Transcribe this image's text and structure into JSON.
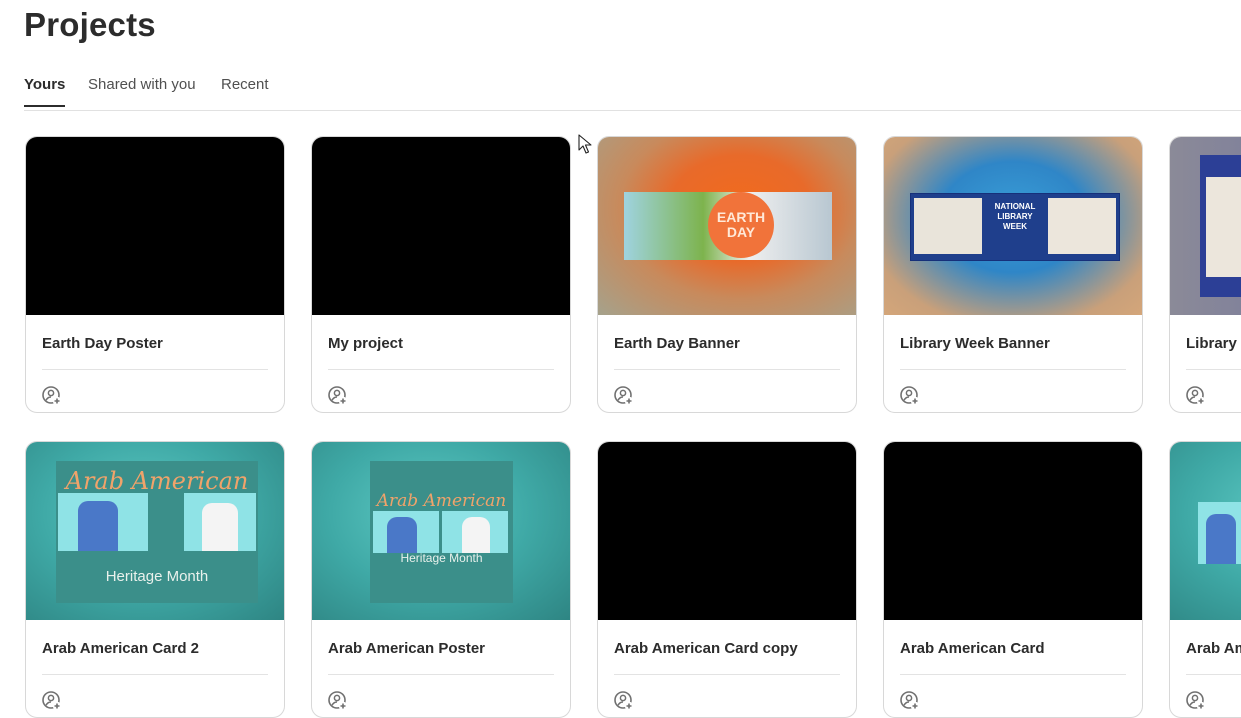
{
  "header": {
    "title": "Projects"
  },
  "tabs": [
    {
      "label": "Yours",
      "active": true
    },
    {
      "label": "Shared with you",
      "active": false
    },
    {
      "label": "Recent",
      "active": false
    }
  ],
  "projects": [
    {
      "title": "Earth Day Poster",
      "thumbnail": "black"
    },
    {
      "title": "My project",
      "thumbnail": "black"
    },
    {
      "title": "Earth Day Banner",
      "thumbnail": "earth-day-banner",
      "thumb_text": "EARTH DAY"
    },
    {
      "title": "Library Week Banner",
      "thumbnail": "library-week-banner",
      "thumb_text": "NATIONAL LIBRARY WEEK"
    },
    {
      "title": "Library W",
      "thumbnail": "library-week-partial"
    },
    {
      "title": "Arab American Card 2",
      "thumbnail": "arab-american-card",
      "thumb_title": "Arab American",
      "thumb_sub": "Heritage Month"
    },
    {
      "title": "Arab American Poster",
      "thumbnail": "arab-american-poster",
      "thumb_title": "Arab American",
      "thumb_sub": "Heritage Month"
    },
    {
      "title": "Arab American Card copy",
      "thumbnail": "black"
    },
    {
      "title": "Arab American Card",
      "thumbnail": "black"
    },
    {
      "title": "Arab Am",
      "thumbnail": "arab-american-partial"
    }
  ],
  "icons": {
    "share": "add-person-icon",
    "cursor": "mouse-pointer-icon"
  },
  "colors": {
    "text": "#2c2c2c",
    "border": "#d8d8d8",
    "earth_orange": "#f26b1d",
    "teal": "#3fa9a6"
  }
}
